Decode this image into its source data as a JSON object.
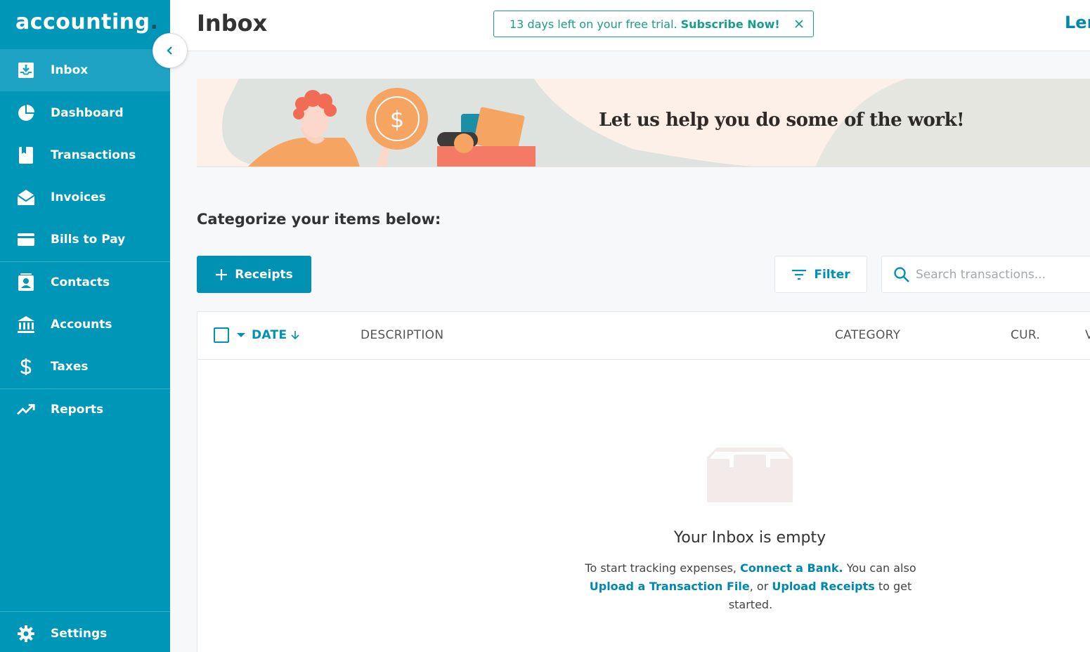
{
  "app": {
    "logo": "accounting",
    "logo_dot": "."
  },
  "sidebar": {
    "items": [
      {
        "label": "Inbox",
        "icon": "inbox-icon",
        "active": true
      },
      {
        "label": "Dashboard",
        "icon": "pie-chart-icon"
      },
      {
        "label": "Transactions",
        "icon": "book-icon"
      },
      {
        "label": "Invoices",
        "icon": "envelope-icon"
      },
      {
        "label": "Bills to Pay",
        "icon": "credit-card-icon"
      },
      {
        "label": "Contacts",
        "icon": "contact-card-icon"
      },
      {
        "label": "Accounts",
        "icon": "bank-icon"
      },
      {
        "label": "Taxes",
        "icon": "dollar-icon"
      },
      {
        "label": "Reports",
        "icon": "trend-icon"
      }
    ],
    "settings_label": "Settings"
  },
  "header": {
    "title": "Inbox",
    "trial_text": "13 days left on your free trial.",
    "trial_cta": "Subscribe Now!",
    "user_name": "Lenny"
  },
  "promo": {
    "text": "Let us help you do some of the work!"
  },
  "main": {
    "section_title": "Categorize your items below:",
    "receipts_button": "Receipts",
    "filter_button": "Filter",
    "search_placeholder": "Search transactions..."
  },
  "table": {
    "columns": [
      "DATE",
      "DESCRIPTION",
      "CATEGORY",
      "CUR.",
      "V"
    ]
  },
  "empty_state": {
    "title": "Your Inbox is empty",
    "text_1": "To start tracking expenses,",
    "link_1": "Connect a Bank.",
    "text_2": "You can also",
    "link_2": "Upload a Transaction File",
    "text_3": ", or",
    "link_3": "Upload Receipts",
    "text_4": "to get started."
  },
  "colors": {
    "sidebar": "#0096b8",
    "accent": "#0091b3",
    "trial": "#1a9d8a"
  }
}
